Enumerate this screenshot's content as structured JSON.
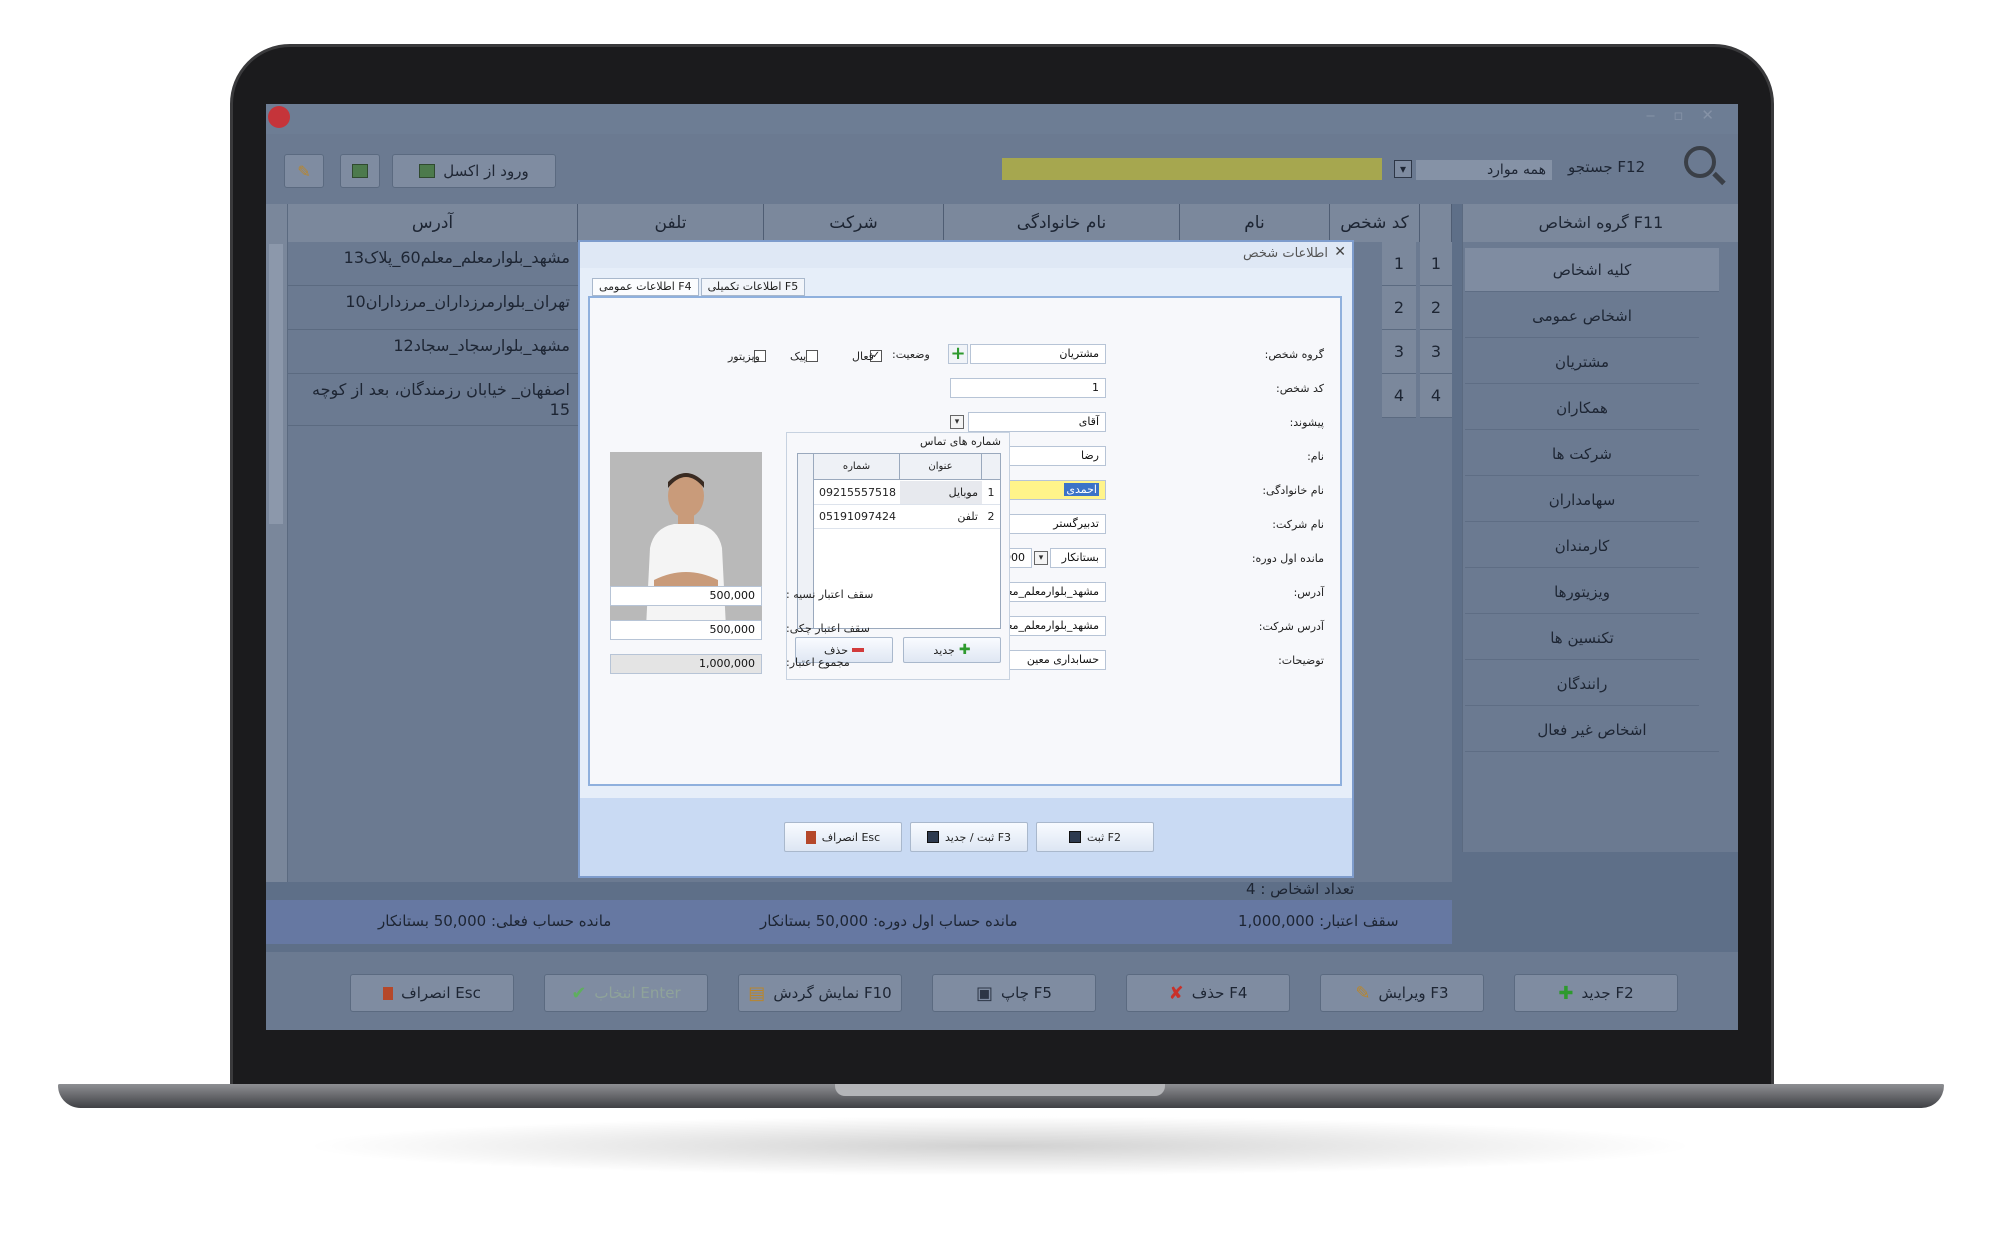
{
  "toolbar": {
    "excel_button": "ورود از اکسل",
    "filter_value": "همه موارد",
    "search_label": "جستجو F12"
  },
  "grid": {
    "headers": {
      "code": "کد شخص",
      "name": "نام",
      "family": "نام خانوادگی",
      "company": "شرکت",
      "phone": "تلفن",
      "address": "آدرس"
    },
    "rows": [
      {
        "num": "1",
        "code": "1",
        "address": "مشهد_بلوارمعلم_معلم60_پلاک13"
      },
      {
        "num": "2",
        "code": "2",
        "address": "تهران_بلوارمرزداران_مرزداران10"
      },
      {
        "num": "3",
        "code": "3",
        "address": "مشهد_بلوارسجاد_سجاد12"
      },
      {
        "num": "4",
        "code": "4",
        "address": "اصفهان_ خیابان رزمندگان، بعد از کوچه 15"
      }
    ],
    "count_label": "تعداد اشخاص : 4"
  },
  "sidebar": {
    "header": "گروه اشخاص F11",
    "items": [
      "کلیه اشخاص",
      "اشخاص عمومی",
      "مشتریان",
      "همکاران",
      "شرکت ها",
      "سهامداران",
      "کارمندان",
      "ویزیتورها",
      "تکنسین ها",
      "رانندگان",
      "اشخاص غیر فعال"
    ]
  },
  "status": {
    "credit_ceiling": "سقف اعتبار: 1,000,000",
    "opening_balance": "مانده حساب اول دوره: 50,000 بستانکار",
    "current_balance": "مانده حساب فعلی: 50,000 بستانکار"
  },
  "bottom_buttons": {
    "new": "جدید F2",
    "edit": "ویرایش F3",
    "delete": "حذف F4",
    "print": "چاپ F5",
    "turnover": "نمایش گردش F10",
    "select": "انتخاب Enter",
    "cancel": "انصراف Esc"
  },
  "dialog": {
    "title": "اطلاعات شخص",
    "tab_general": "اطلاعات عمومی F4",
    "tab_extra": "اطلاعات تکمیلی F5",
    "labels": {
      "group": "گروه شخص:",
      "code": "کد شخص:",
      "prefix": "پیشوند:",
      "name": "نام:",
      "family": "نام خانوادگی:",
      "company": "نام شرکت:",
      "opening": "مانده اول دوره:",
      "address": "آدرس:",
      "company_address": "آدرس شرکت:",
      "notes": "توضیحات:",
      "status": "وضعیت:",
      "active": "فعال",
      "courier": "پیک",
      "visitor": "ویزیتور",
      "contacts": "شماره های تماس",
      "credit_installment": "سقف اعتبار نسیه :",
      "credit_cheque": "سقف اعتبار چکی:",
      "credit_total": "مجموع اعتبار:"
    },
    "values": {
      "group": "مشتریان",
      "code": "1",
      "prefix": "آقای",
      "name": "رضا",
      "family": "احمدی",
      "company": "تدبیرگستر",
      "opening_type": "بستانکار",
      "opening_amount": "50,000",
      "address": "مشهد_بلوارمعلم_معلم60_پلاک13",
      "company_address": "مشهد_بلوارمعلم_معلم60_پلاک13",
      "notes": "حسابداری معین",
      "credit_installment": "500,000",
      "credit_cheque": "500,000",
      "credit_total": "1,000,000"
    },
    "contacts_table": {
      "col_title": "عنوان",
      "col_number": "شماره",
      "rows": [
        {
          "num": "1",
          "title": "موبایل",
          "number": "09215557518"
        },
        {
          "num": "2",
          "title": "تلفن",
          "number": "05191097424"
        }
      ],
      "new_button": "جدید",
      "delete_button": "حذف"
    },
    "footer": {
      "save": "ثبت F2",
      "save_new": "ثبت / جدید F3",
      "cancel": "انصراف Esc"
    }
  }
}
